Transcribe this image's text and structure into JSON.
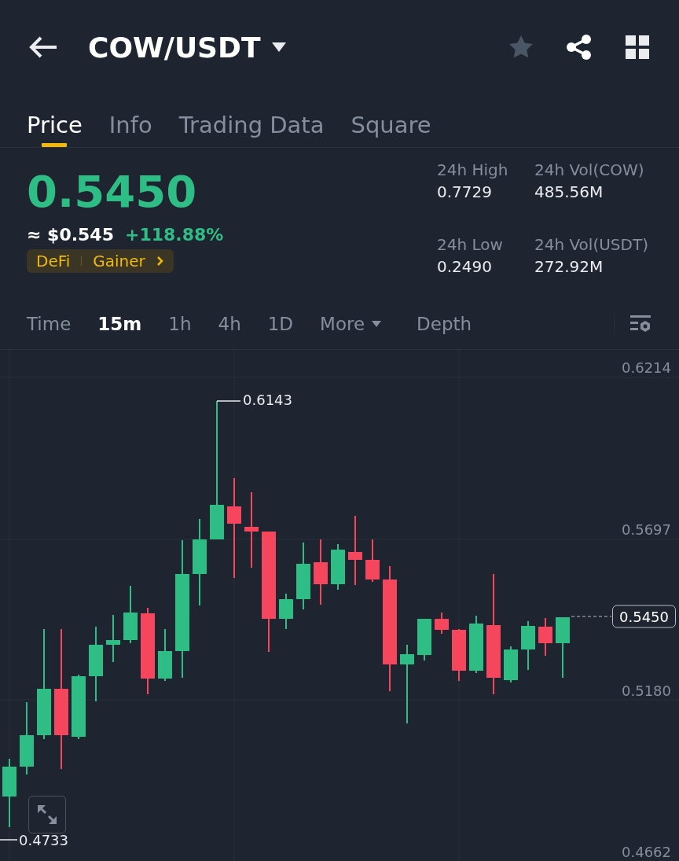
{
  "header": {
    "title": "COW/USDT"
  },
  "tabs": [
    {
      "label": "Price",
      "selected": true
    },
    {
      "label": "Info",
      "selected": false
    },
    {
      "label": "Trading Data",
      "selected": false
    },
    {
      "label": "Square",
      "selected": false
    }
  ],
  "price": {
    "last": "0.5450",
    "fiat": "≈ $0.545",
    "change": "+118.88%",
    "tags": [
      "DeFi",
      "Gainer"
    ]
  },
  "stats": [
    {
      "label": "24h High",
      "value": "0.7729"
    },
    {
      "label": "24h Vol(COW)",
      "value": "485.56M"
    },
    {
      "label": "24h Low",
      "value": "0.2490"
    },
    {
      "label": "24h Vol(USDT)",
      "value": "272.92M"
    }
  ],
  "intervals": [
    {
      "label": "Time",
      "selected": false
    },
    {
      "label": "15m",
      "selected": true
    },
    {
      "label": "1h",
      "selected": false
    },
    {
      "label": "4h",
      "selected": false
    },
    {
      "label": "1D",
      "selected": false
    }
  ],
  "more": "More",
  "depth": "Depth",
  "chart": {
    "axis_labels": [
      "0.6214",
      "0.5697",
      "0.5180",
      "0.4662"
    ],
    "high_marker": "0.6143",
    "low_marker": "0.4733",
    "current_price": "0.5450"
  }
}
